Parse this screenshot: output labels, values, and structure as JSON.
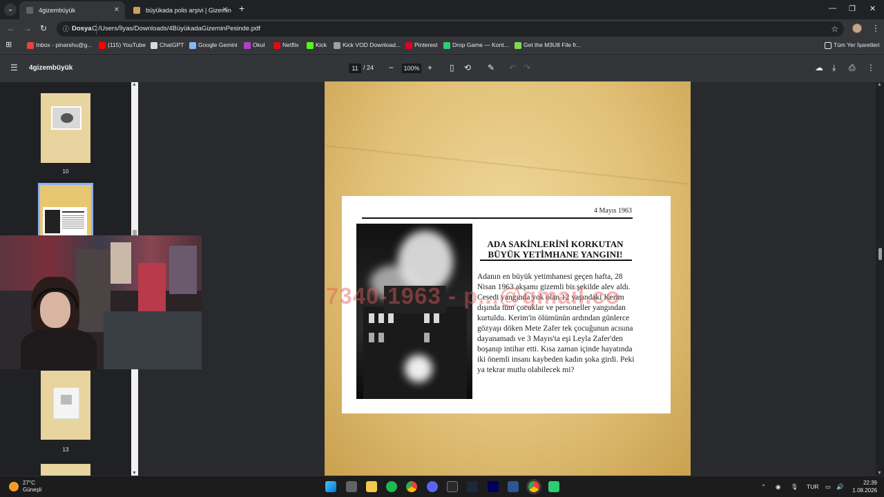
{
  "browser": {
    "tabs": [
      {
        "title": "4gizembüyük",
        "active": true
      },
      {
        "title": "büyükada polis arşivi | Gizemin",
        "active": false
      }
    ],
    "new_tab_icon": "plus",
    "address": {
      "chip": "Dosya",
      "url": "C:/Users/İlyas/Downloads/4BüyükadaGizeminPesinde.pdf"
    },
    "bookmarks": [
      {
        "label": "Inbox - pinarshu@g...",
        "color": "#ea4335"
      },
      {
        "label": "(115) YouTube",
        "color": "#ff0000"
      },
      {
        "label": "ChatGPT",
        "color": "#d9d9d9"
      },
      {
        "label": "Google Gemini",
        "color": "#8ab4f8"
      },
      {
        "label": "Okul",
        "color": "#b23ec9"
      },
      {
        "label": "Netflix",
        "color": "#e50914"
      },
      {
        "label": "Kick",
        "color": "#53fc18"
      },
      {
        "label": "Kick VOD Download...",
        "color": "#9aa0a6"
      },
      {
        "label": "Pinterest",
        "color": "#e60023"
      },
      {
        "label": "Drop Game — Kont...",
        "color": "#2ecc71"
      },
      {
        "label": "Get the M3U8 File fr...",
        "color": "#7ed957"
      }
    ],
    "all_bookmarks": "Tüm Yer İşaretleri"
  },
  "pdf": {
    "title": "4gizembüyük",
    "current_page": "11",
    "total_pages": "/ 24",
    "zoom": "100%",
    "thumbnails": [
      {
        "number": "10"
      },
      {
        "number": "13"
      }
    ]
  },
  "article": {
    "date": "4 Mayıs 1963",
    "headline_line1": "ADA SAKİNLERİNİ KORKUTAN",
    "headline_line2": "BÜYÜK YETİMHANE YANGINI!",
    "body": "Adanın en büyük yetimhanesi geçen hafta, 28 Nisan 1963 akşamı gizemli bir şekilde alev aldı. Cesedi yangında yok olan 12 yaşındaki Kerim dışında tüm çocuklar ve personeller yangından kurtuldu. Kerim'in ölümünün ardından günlerce gözyaşı döken Mete Zafer tek çocuğunun acısına dayanamadı ve 3 Mayıs'ta  eşi Leyla Zafer'den boşanıp intihar etti. Kısa zaman içinde hayatında iki önemli insanı kaybeden kadın şoka girdi. Peki ya tekrar mutlu olabilecek mi?"
  },
  "watermark": "7340-1963 - p...@gmail.co",
  "taskbar": {
    "temperature": "27°C",
    "condition": "Güneşli",
    "language": "TUR",
    "time": "22:39",
    "date": "1.08.2026"
  }
}
